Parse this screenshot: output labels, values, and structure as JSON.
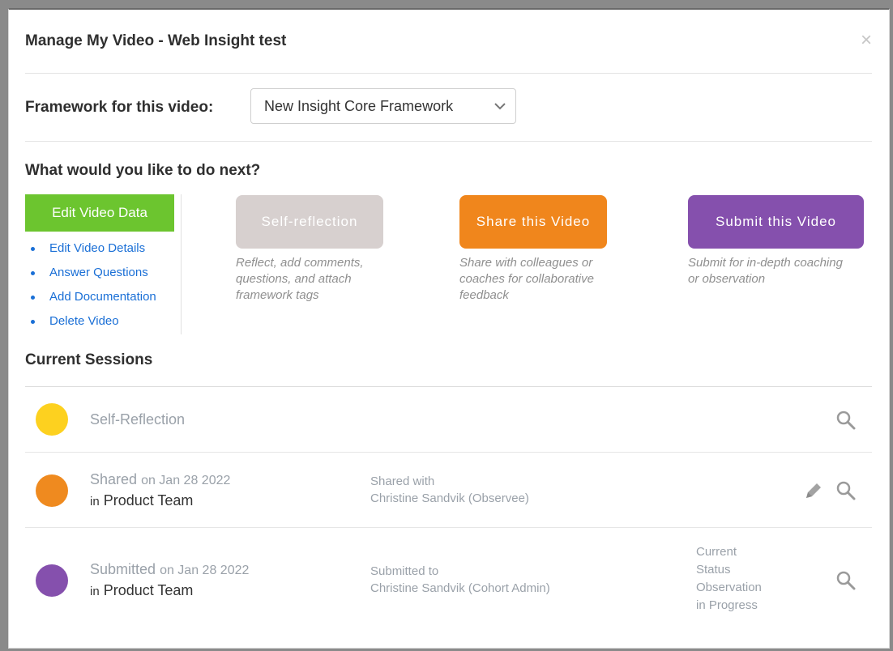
{
  "modal": {
    "title": "Manage My Video - Web Insight test",
    "close_label": "×"
  },
  "framework": {
    "label": "Framework for this video:",
    "selected": "New Insight Core Framework"
  },
  "next": {
    "title": "What would you like to do next?",
    "edit_button": "Edit Video Data",
    "edit_links": [
      "Edit Video Details",
      "Answer Questions",
      "Add Documentation",
      "Delete Video"
    ],
    "actions": [
      {
        "label": "Self-reflection",
        "desc": "Reflect, add comments, questions, and attach framework tags",
        "color": "#d7d0cf"
      },
      {
        "label": "Share this Video",
        "desc": "Share with colleagues or coaches for collaborative feedback",
        "color": "#f0861c"
      },
      {
        "label": "Submit this Video",
        "desc": "Submit for in-depth coaching or observation",
        "color": "#8550ad"
      }
    ]
  },
  "sessions": {
    "title": "Current Sessions",
    "rows": [
      {
        "name": "Self-Reflection",
        "color": "#fdd11f"
      },
      {
        "name": "Shared",
        "date": "on Jan 28 2022",
        "team_prefix": "in",
        "team": "Product Team",
        "label": "Shared with",
        "person": "Christine Sandvik (Observee)",
        "color": "#ef8a1f"
      },
      {
        "name": "Submitted",
        "date": "on Jan 28 2022",
        "team_prefix": "in",
        "team": "Product Team",
        "label": "Submitted to",
        "person": "Christine Sandvik (Cohort Admin)",
        "status_lines": [
          "Current",
          "Status",
          "Observation",
          "in Progress"
        ],
        "color": "#8550ad"
      }
    ]
  },
  "colors": {
    "link": "#1a6fd6",
    "muted_text": "#9aa1a9",
    "green_button": "#6cc52f",
    "icon": "#9a9a9a"
  }
}
